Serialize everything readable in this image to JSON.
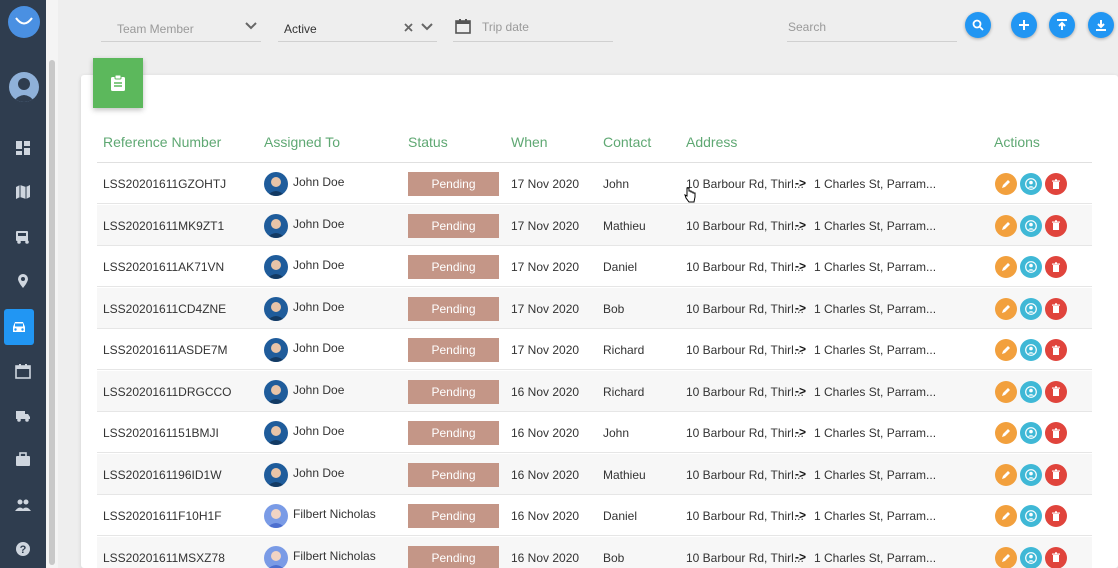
{
  "colors": {
    "sidebar": "#2f3d4f",
    "accent": "#2196f3",
    "header_text": "#5fa873",
    "status_pending": "#c49687",
    "edit": "#f2a03d",
    "assign": "#3fb8d6",
    "delete": "#e0443c",
    "card_badge": "#5cb85c"
  },
  "sidebar": {
    "items": [
      {
        "icon": "dashboard-icon"
      },
      {
        "icon": "map-icon"
      },
      {
        "icon": "bus-icon"
      },
      {
        "icon": "location-pin-icon"
      },
      {
        "icon": "car-icon",
        "active": true
      },
      {
        "icon": "calendar-icon"
      },
      {
        "icon": "truck-icon"
      },
      {
        "icon": "briefcase-icon"
      },
      {
        "icon": "people-icon"
      },
      {
        "icon": "help-icon"
      }
    ]
  },
  "filters": {
    "team_member_placeholder": "Team Member",
    "status_value": "Active",
    "trip_date_placeholder": "Trip date",
    "search_placeholder": "Search"
  },
  "table": {
    "headers": {
      "reference": "Reference Number",
      "assigned": "Assigned To",
      "status": "Status",
      "when": "When",
      "contact": "Contact",
      "address": "Address",
      "actions": "Actions"
    },
    "arrow": "->",
    "rows": [
      {
        "ref": "LSS20201611GZOHTJ",
        "assigned": "John Doe",
        "status": "Pending",
        "when": "17 Nov 2020",
        "contact": "John",
        "from": "10 Barbour Rd, Thirl...",
        "to": "1 Charles St, Parram..."
      },
      {
        "ref": "LSS20201611MK9ZT1",
        "assigned": "John Doe",
        "status": "Pending",
        "when": "17 Nov 2020",
        "contact": "Mathieu",
        "from": "10 Barbour Rd, Thirl...",
        "to": "1 Charles St, Parram..."
      },
      {
        "ref": "LSS20201611AK71VN",
        "assigned": "John Doe",
        "status": "Pending",
        "when": "17 Nov 2020",
        "contact": "Daniel",
        "from": "10 Barbour Rd, Thirl...",
        "to": "1 Charles St, Parram..."
      },
      {
        "ref": "LSS20201611CD4ZNE",
        "assigned": "John Doe",
        "status": "Pending",
        "when": "17 Nov 2020",
        "contact": "Bob",
        "from": "10 Barbour Rd, Thirl...",
        "to": "1 Charles St, Parram..."
      },
      {
        "ref": "LSS20201611ASDE7M",
        "assigned": "John Doe",
        "status": "Pending",
        "when": "17 Nov 2020",
        "contact": "Richard",
        "from": "10 Barbour Rd, Thirl...",
        "to": "1 Charles St, Parram..."
      },
      {
        "ref": "LSS20201611DRGCCO",
        "assigned": "John Doe",
        "status": "Pending",
        "when": "16 Nov 2020",
        "contact": "Richard",
        "from": "10 Barbour Rd, Thirl...",
        "to": "1 Charles St, Parram..."
      },
      {
        "ref": "LSS2020161151BMJI",
        "assigned": "John Doe",
        "status": "Pending",
        "when": "16 Nov 2020",
        "contact": "John",
        "from": "10 Barbour Rd, Thirl...",
        "to": "1 Charles St, Parram..."
      },
      {
        "ref": "LSS2020161196ID1W",
        "assigned": "John Doe",
        "status": "Pending",
        "when": "16 Nov 2020",
        "contact": "Mathieu",
        "from": "10 Barbour Rd, Thirl...",
        "to": "1 Charles St, Parram..."
      },
      {
        "ref": "LSS20201611F10H1F",
        "assigned": "Filbert Nicholas",
        "status": "Pending",
        "when": "16 Nov 2020",
        "contact": "Daniel",
        "from": "10 Barbour Rd, Thirl...",
        "to": "1 Charles St, Parram..."
      },
      {
        "ref": "LSS20201611MSXZ78",
        "assigned": "Filbert Nicholas",
        "status": "Pending",
        "when": "16 Nov 2020",
        "contact": "Bob",
        "from": "10 Barbour Rd, Thirl...",
        "to": "1 Charles St, Parram..."
      }
    ]
  }
}
